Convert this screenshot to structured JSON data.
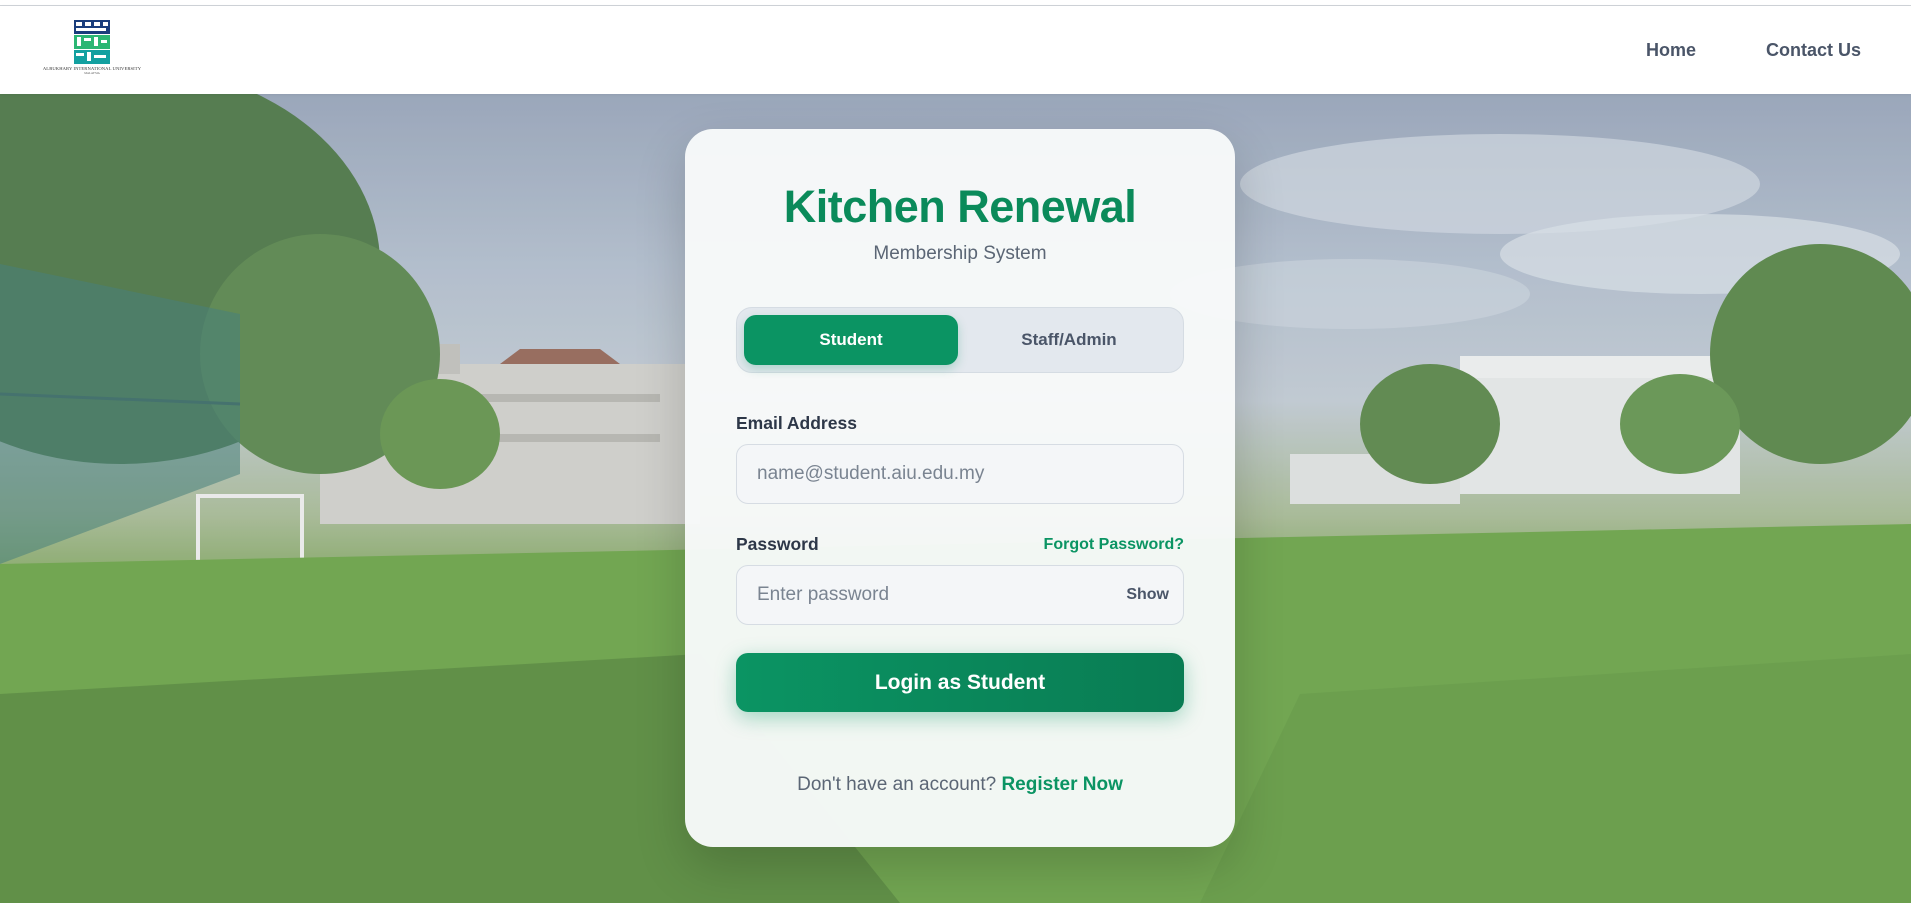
{
  "header": {
    "logo_caption": "ALBUKHARY INTERNATIONAL UNIVERSITY",
    "logo_sub": "MALAYSIA",
    "nav": [
      {
        "label": "Home"
      },
      {
        "label": "Contact Us"
      }
    ]
  },
  "card": {
    "title": "Kitchen Renewal",
    "subtitle": "Membership System",
    "roles": [
      {
        "label": "Student",
        "active": true
      },
      {
        "label": "Staff/Admin",
        "active": false
      }
    ],
    "email": {
      "label": "Email Address",
      "placeholder": "name@student.aiu.edu.my",
      "value": ""
    },
    "password": {
      "label": "Password",
      "placeholder": "Enter password",
      "value": "",
      "forgot_label": "Forgot Password?",
      "show_label": "Show"
    },
    "login_label": "Login as Student",
    "register_prompt": "Don't have an account?",
    "register_link": "Register Now"
  },
  "colors": {
    "accent": "#0b9463",
    "title": "#0a8a5a",
    "text_muted": "#5b6675"
  },
  "icons": [
    "university-logo"
  ]
}
